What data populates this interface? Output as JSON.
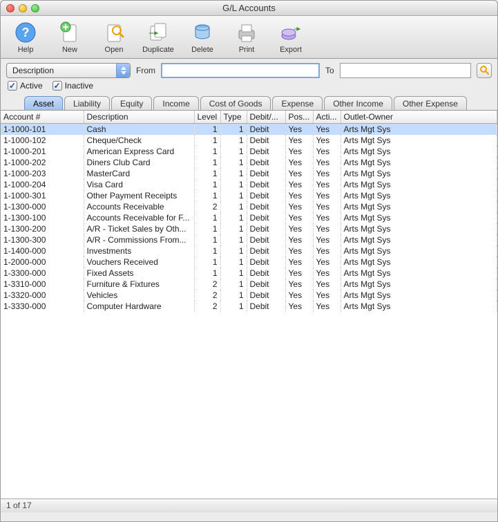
{
  "window": {
    "title": "G/L Accounts"
  },
  "toolbar": {
    "help": "Help",
    "new": "New",
    "open": "Open",
    "duplicate": "Duplicate",
    "delete": "Delete",
    "print": "Print",
    "export": "Export"
  },
  "filter": {
    "select_value": "Description",
    "from_label": "From",
    "to_label": "To",
    "from_value": "",
    "to_value": "",
    "active_label": "Active",
    "inactive_label": "Inactive",
    "active_checked": true,
    "inactive_checked": true
  },
  "tabs": [
    {
      "label": "Asset",
      "active": true
    },
    {
      "label": "Liability",
      "active": false
    },
    {
      "label": "Equity",
      "active": false
    },
    {
      "label": "Income",
      "active": false
    },
    {
      "label": "Cost of Goods",
      "active": false
    },
    {
      "label": "Expense",
      "active": false
    },
    {
      "label": "Other Income",
      "active": false
    },
    {
      "label": "Other Expense",
      "active": false
    }
  ],
  "table": {
    "headers": {
      "account": "Account #",
      "description": "Description",
      "level": "Level",
      "type": "Type",
      "debitcredit": "Debit/...",
      "posting": "Pos...",
      "active": "Acti...",
      "owner": "Outlet-Owner"
    },
    "rows": [
      {
        "acct": "1-1000-101",
        "desc": "Cash",
        "level": 1,
        "type": 1,
        "dc": "Debit",
        "post": "Yes",
        "active": "Yes",
        "owner": "Arts Mgt Sys",
        "selected": true
      },
      {
        "acct": "1-1000-102",
        "desc": "Cheque/Check",
        "level": 1,
        "type": 1,
        "dc": "Debit",
        "post": "Yes",
        "active": "Yes",
        "owner": "Arts Mgt Sys"
      },
      {
        "acct": "1-1000-201",
        "desc": "American Express Card",
        "level": 1,
        "type": 1,
        "dc": "Debit",
        "post": "Yes",
        "active": "Yes",
        "owner": "Arts Mgt Sys"
      },
      {
        "acct": "1-1000-202",
        "desc": "Diners Club Card",
        "level": 1,
        "type": 1,
        "dc": "Debit",
        "post": "Yes",
        "active": "Yes",
        "owner": "Arts Mgt Sys"
      },
      {
        "acct": "1-1000-203",
        "desc": "MasterCard",
        "level": 1,
        "type": 1,
        "dc": "Debit",
        "post": "Yes",
        "active": "Yes",
        "owner": "Arts Mgt Sys"
      },
      {
        "acct": "1-1000-204",
        "desc": "Visa Card",
        "level": 1,
        "type": 1,
        "dc": "Debit",
        "post": "Yes",
        "active": "Yes",
        "owner": "Arts Mgt Sys"
      },
      {
        "acct": "1-1000-301",
        "desc": "Other Payment Receipts",
        "level": 1,
        "type": 1,
        "dc": "Debit",
        "post": "Yes",
        "active": "Yes",
        "owner": "Arts Mgt Sys"
      },
      {
        "acct": "1-1300-000",
        "desc": "Accounts Receivable",
        "level": 2,
        "type": 1,
        "dc": "Debit",
        "post": "Yes",
        "active": "Yes",
        "owner": "Arts Mgt Sys"
      },
      {
        "acct": "1-1300-100",
        "desc": "Accounts Receivable for F...",
        "level": 1,
        "type": 1,
        "dc": "Debit",
        "post": "Yes",
        "active": "Yes",
        "owner": "Arts Mgt Sys"
      },
      {
        "acct": "1-1300-200",
        "desc": "A/R - Ticket Sales by Oth...",
        "level": 1,
        "type": 1,
        "dc": "Debit",
        "post": "Yes",
        "active": "Yes",
        "owner": "Arts Mgt Sys"
      },
      {
        "acct": "1-1300-300",
        "desc": "A/R - Commissions From...",
        "level": 1,
        "type": 1,
        "dc": "Debit",
        "post": "Yes",
        "active": "Yes",
        "owner": "Arts Mgt Sys"
      },
      {
        "acct": "1-1400-000",
        "desc": "Investments",
        "level": 1,
        "type": 1,
        "dc": "Debit",
        "post": "Yes",
        "active": "Yes",
        "owner": "Arts Mgt Sys"
      },
      {
        "acct": "1-2000-000",
        "desc": "Vouchers Received",
        "level": 1,
        "type": 1,
        "dc": "Debit",
        "post": "Yes",
        "active": "Yes",
        "owner": "Arts Mgt Sys"
      },
      {
        "acct": "1-3300-000",
        "desc": "Fixed Assets",
        "level": 1,
        "type": 1,
        "dc": "Debit",
        "post": "Yes",
        "active": "Yes",
        "owner": "Arts Mgt Sys"
      },
      {
        "acct": "1-3310-000",
        "desc": "Furniture & Fixtures",
        "level": 2,
        "type": 1,
        "dc": "Debit",
        "post": "Yes",
        "active": "Yes",
        "owner": "Arts Mgt Sys"
      },
      {
        "acct": "1-3320-000",
        "desc": "Vehicles",
        "level": 2,
        "type": 1,
        "dc": "Debit",
        "post": "Yes",
        "active": "Yes",
        "owner": "Arts Mgt Sys"
      },
      {
        "acct": "1-3330-000",
        "desc": "Computer Hardware",
        "level": 2,
        "type": 1,
        "dc": "Debit",
        "post": "Yes",
        "active": "Yes",
        "owner": "Arts Mgt Sys"
      }
    ]
  },
  "status": {
    "text": "1 of 17"
  }
}
